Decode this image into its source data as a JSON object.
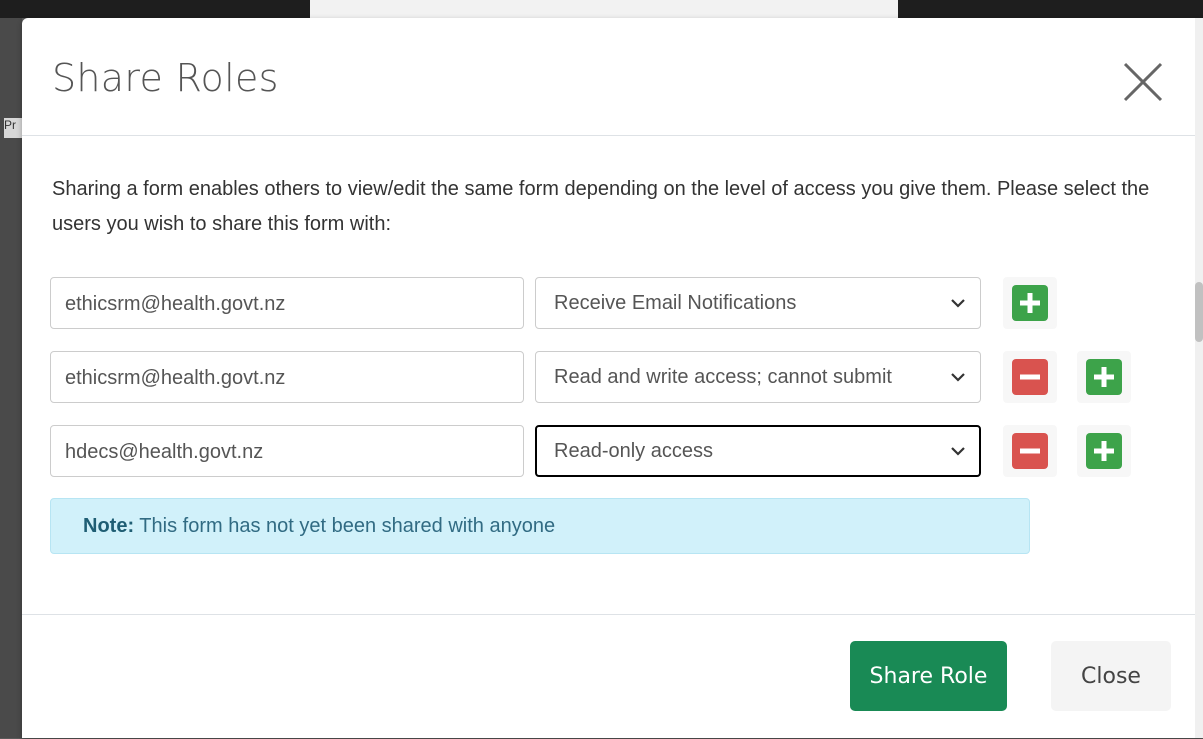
{
  "modal": {
    "title": "Share Roles",
    "intro": "Sharing a form enables others to view/edit the same form depending on the level of access you give them. Please select the users you wish to share this form with:",
    "rows": [
      {
        "email": "ethicsrm@health.govt.nz",
        "role": "Receive Email Notifications"
      },
      {
        "email": "ethicsrm@health.govt.nz",
        "role": "Read and write access; cannot submit"
      },
      {
        "email": "hdecs@health.govt.nz",
        "role": "Read-only access"
      }
    ],
    "note_label": "Note:",
    "note_text": " This form has not yet been shared with anyone",
    "share_button": "Share Role",
    "close_button": "Close"
  },
  "colors": {
    "primary": "#198a55",
    "add": "#3da34a",
    "remove": "#d9534f",
    "note_bg": "#d1f1fa"
  },
  "background": {
    "fragment_text": "Pr"
  }
}
